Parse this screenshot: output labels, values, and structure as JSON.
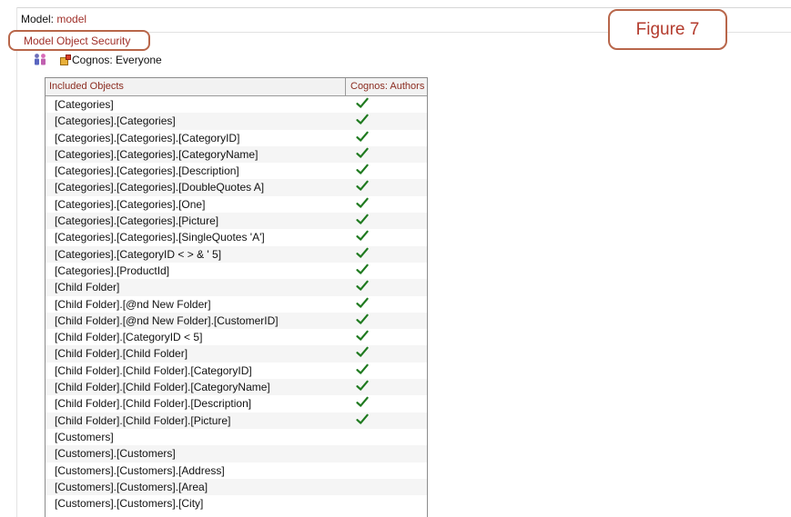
{
  "model": {
    "label": "Model:",
    "value": "model"
  },
  "section_title": "Model Object Security",
  "figure_label": "Figure 7",
  "security_group": {
    "name": "Cognos: Everyone",
    "icon": "group-icon"
  },
  "table": {
    "columns": [
      "Included Objects",
      "Cognos: Authors"
    ],
    "rows": [
      {
        "object": "[Categories]",
        "checked": true
      },
      {
        "object": "[Categories].[Categories]",
        "checked": true
      },
      {
        "object": "[Categories].[Categories].[CategoryID]",
        "checked": true
      },
      {
        "object": "[Categories].[Categories].[CategoryName]",
        "checked": true
      },
      {
        "object": "[Categories].[Categories].[Description]",
        "checked": true
      },
      {
        "object": "[Categories].[Categories].[DoubleQuotes A]",
        "checked": true
      },
      {
        "object": "[Categories].[Categories].[One]",
        "checked": true
      },
      {
        "object": "[Categories].[Categories].[Picture]",
        "checked": true
      },
      {
        "object": "[Categories].[Categories].[SingleQuotes 'A']",
        "checked": true
      },
      {
        "object": "[Categories].[CategoryID < > & ' 5]",
        "checked": true
      },
      {
        "object": "[Categories].[ProductId]",
        "checked": true
      },
      {
        "object": "[Child Folder]",
        "checked": true
      },
      {
        "object": "[Child Folder].[@nd New Folder]",
        "checked": true
      },
      {
        "object": "[Child Folder].[@nd New Folder].[CustomerID]",
        "checked": true
      },
      {
        "object": "[Child Folder].[CategoryID < 5]",
        "checked": true
      },
      {
        "object": "[Child Folder].[Child Folder]",
        "checked": true
      },
      {
        "object": "[Child Folder].[Child Folder].[CategoryID]",
        "checked": true
      },
      {
        "object": "[Child Folder].[Child Folder].[CategoryName]",
        "checked": true
      },
      {
        "object": "[Child Folder].[Child Folder].[Description]",
        "checked": true
      },
      {
        "object": "[Child Folder].[Child Folder].[Picture]",
        "checked": true
      },
      {
        "object": "[Customers]",
        "checked": false
      },
      {
        "object": "[Customers].[Customers]",
        "checked": false
      },
      {
        "object": "[Customers].[Customers].[Address]",
        "checked": false
      },
      {
        "object": "[Customers].[Customers].[Area]",
        "checked": false
      },
      {
        "object": "[Customers].[Customers].[City]",
        "checked": false
      }
    ]
  },
  "colors": {
    "accent": "#a0302a",
    "callout_border": "#b8664a",
    "check": "#1f7a1f"
  }
}
